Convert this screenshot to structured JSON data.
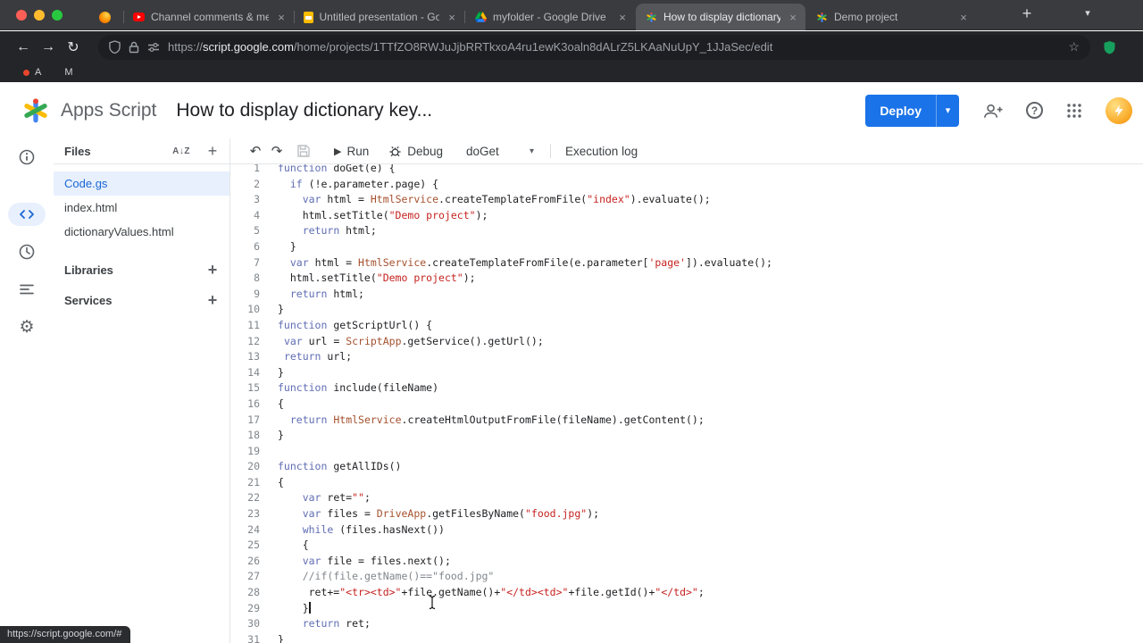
{
  "colors": {
    "accent_blue": "#1a73e8",
    "selected_file_bg": "#e8f0fe",
    "selected_file_text": "#1967d2",
    "keyword": "#5f6db3",
    "class_name": "#a5502d",
    "string": "#c5221f",
    "comment": "#80868b"
  },
  "browser": {
    "tabs": [
      {
        "icon": "firefox",
        "title": "",
        "mini": true,
        "active": false
      },
      {
        "icon": "youtube",
        "title": "Channel comments & mentions",
        "mini": false,
        "active": false
      },
      {
        "icon": "slides",
        "title": "Untitled presentation - Google S",
        "mini": false,
        "active": false
      },
      {
        "icon": "drive",
        "title": "myfolder - Google Drive",
        "mini": false,
        "active": false
      },
      {
        "icon": "appsscript",
        "title": "How to display dictionary keys,v",
        "mini": false,
        "active": true
      },
      {
        "icon": "appsscript",
        "title": "Demo project",
        "mini": false,
        "active": false
      }
    ],
    "url_scheme": "https://",
    "url_host": "script.google.com",
    "url_path": "/home/projects/1TTfZO8RWJuJjbRRTkxoA4ru1ewK3oaln8dALrZ5LKAaNuUpY_1JJaSec/edit",
    "bookmarks": [
      {
        "label": "A",
        "dot": true
      },
      {
        "label": "M",
        "dot": false
      }
    ],
    "status_link": "https://script.google.com/#"
  },
  "header": {
    "product_name": "Apps Script",
    "project_title": "How to display dictionary key...",
    "deploy_label": "Deploy"
  },
  "sidebar": {
    "files_title": "Files",
    "files": [
      {
        "name": "Code.gs",
        "selected": true
      },
      {
        "name": "index.html",
        "selected": false
      },
      {
        "name": "dictionaryValues.html",
        "selected": false
      }
    ],
    "sections": [
      {
        "label": "Libraries"
      },
      {
        "label": "Services"
      }
    ]
  },
  "toolbar": {
    "run_label": "Run",
    "debug_label": "Debug",
    "function_name": "doGet",
    "execution_log_label": "Execution log"
  },
  "editor": {
    "cursor_line": 29,
    "lines": [
      {
        "n": 1,
        "t": [
          [
            "kw",
            "function"
          ],
          [
            "d",
            " doGet(e) {"
          ]
        ]
      },
      {
        "n": 2,
        "t": [
          [
            "d",
            "  "
          ],
          [
            "kw",
            "if"
          ],
          [
            "d",
            " (!e.parameter.page) {"
          ]
        ]
      },
      {
        "n": 3,
        "t": [
          [
            "d",
            "    "
          ],
          [
            "kw",
            "var"
          ],
          [
            "d",
            " html = "
          ],
          [
            "cl",
            "HtmlService"
          ],
          [
            "d",
            ".createTemplateFromFile("
          ],
          [
            "st",
            "\"index\""
          ],
          [
            "d",
            ").evaluate();"
          ]
        ]
      },
      {
        "n": 4,
        "t": [
          [
            "d",
            "    html.setTitle("
          ],
          [
            "st",
            "\"Demo project\""
          ],
          [
            "d",
            ");"
          ]
        ]
      },
      {
        "n": 5,
        "t": [
          [
            "d",
            "    "
          ],
          [
            "kw",
            "return"
          ],
          [
            "d",
            " html;"
          ]
        ]
      },
      {
        "n": 6,
        "t": [
          [
            "d",
            "  }"
          ]
        ]
      },
      {
        "n": 7,
        "t": [
          [
            "d",
            "  "
          ],
          [
            "kw",
            "var"
          ],
          [
            "d",
            " html = "
          ],
          [
            "cl",
            "HtmlService"
          ],
          [
            "d",
            ".createTemplateFromFile(e.parameter["
          ],
          [
            "st",
            "'page'"
          ],
          [
            "d",
            "]).evaluate();"
          ]
        ]
      },
      {
        "n": 8,
        "t": [
          [
            "d",
            "  html.setTitle("
          ],
          [
            "st",
            "\"Demo project\""
          ],
          [
            "d",
            ");"
          ]
        ]
      },
      {
        "n": 9,
        "t": [
          [
            "d",
            "  "
          ],
          [
            "kw",
            "return"
          ],
          [
            "d",
            " html;"
          ]
        ]
      },
      {
        "n": 10,
        "t": [
          [
            "d",
            "}"
          ]
        ]
      },
      {
        "n": 11,
        "t": [
          [
            "kw",
            "function"
          ],
          [
            "d",
            " getScriptUrl() {"
          ]
        ]
      },
      {
        "n": 12,
        "t": [
          [
            "d",
            " "
          ],
          [
            "kw",
            "var"
          ],
          [
            "d",
            " url = "
          ],
          [
            "cl",
            "ScriptApp"
          ],
          [
            "d",
            ".getService().getUrl();"
          ]
        ]
      },
      {
        "n": 13,
        "t": [
          [
            "d",
            " "
          ],
          [
            "kw",
            "return"
          ],
          [
            "d",
            " url;"
          ]
        ]
      },
      {
        "n": 14,
        "t": [
          [
            "d",
            "}"
          ]
        ]
      },
      {
        "n": 15,
        "t": [
          [
            "kw",
            "function"
          ],
          [
            "d",
            " include(fileName)"
          ]
        ]
      },
      {
        "n": 16,
        "t": [
          [
            "d",
            "{"
          ]
        ]
      },
      {
        "n": 17,
        "t": [
          [
            "d",
            "  "
          ],
          [
            "kw",
            "return"
          ],
          [
            "d",
            " "
          ],
          [
            "cl",
            "HtmlService"
          ],
          [
            "d",
            ".createHtmlOutputFromFile(fileName).getContent();"
          ]
        ]
      },
      {
        "n": 18,
        "t": [
          [
            "d",
            "}"
          ]
        ]
      },
      {
        "n": 19,
        "t": []
      },
      {
        "n": 20,
        "t": [
          [
            "kw",
            "function"
          ],
          [
            "d",
            " getAllIDs()"
          ]
        ]
      },
      {
        "n": 21,
        "t": [
          [
            "d",
            "{"
          ]
        ]
      },
      {
        "n": 22,
        "t": [
          [
            "d",
            "    "
          ],
          [
            "kw",
            "var"
          ],
          [
            "d",
            " ret="
          ],
          [
            "st",
            "\"\""
          ],
          [
            "d",
            ";"
          ]
        ]
      },
      {
        "n": 23,
        "t": [
          [
            "d",
            "    "
          ],
          [
            "kw",
            "var"
          ],
          [
            "d",
            " files = "
          ],
          [
            "cl",
            "DriveApp"
          ],
          [
            "d",
            ".getFilesByName("
          ],
          [
            "st",
            "\"food.jpg\""
          ],
          [
            "d",
            ");"
          ]
        ]
      },
      {
        "n": 24,
        "t": [
          [
            "d",
            "    "
          ],
          [
            "kw",
            "while"
          ],
          [
            "d",
            " (files.hasNext())"
          ]
        ]
      },
      {
        "n": 25,
        "t": [
          [
            "d",
            "    {"
          ]
        ]
      },
      {
        "n": 26,
        "t": [
          [
            "d",
            "    "
          ],
          [
            "kw",
            "var"
          ],
          [
            "d",
            " file = files.next();"
          ]
        ]
      },
      {
        "n": 27,
        "t": [
          [
            "d",
            "    "
          ],
          [
            "cm",
            "//if(file.getName()==\"food.jpg\""
          ]
        ]
      },
      {
        "n": 28,
        "t": [
          [
            "d",
            "     ret+="
          ],
          [
            "st",
            "\"<tr><td>\""
          ],
          [
            "d",
            "+file.getName()+"
          ],
          [
            "st",
            "\"</td><td>\""
          ],
          [
            "d",
            "+file.getId()+"
          ],
          [
            "st",
            "\"</td>\""
          ],
          [
            "d",
            ";"
          ]
        ]
      },
      {
        "n": 29,
        "t": [
          [
            "d",
            "    }"
          ],
          [
            "caret",
            ""
          ]
        ]
      },
      {
        "n": 30,
        "t": [
          [
            "d",
            "    "
          ],
          [
            "kw",
            "return"
          ],
          [
            "d",
            " ret;"
          ]
        ]
      },
      {
        "n": 31,
        "t": [
          [
            "d",
            "}"
          ]
        ]
      }
    ]
  }
}
